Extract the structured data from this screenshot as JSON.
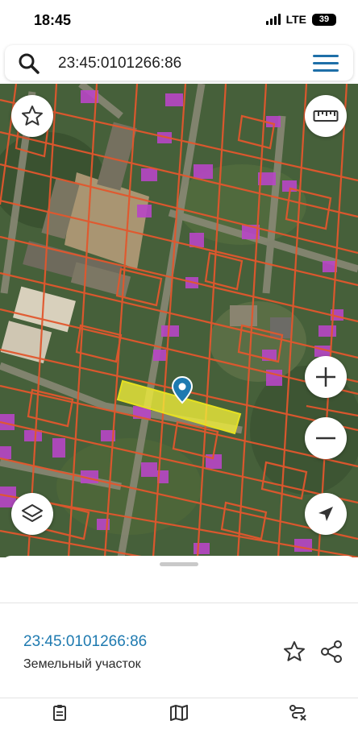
{
  "status": {
    "time": "18:45",
    "network": "LTE",
    "battery": "39"
  },
  "search": {
    "value": "23:45:0101266:86",
    "icon": "search-icon",
    "menu_icon": "hamburger-menu-icon"
  },
  "map": {
    "controls": {
      "favorites_icon": "star-icon",
      "measure_icon": "ruler-icon",
      "zoom_in_icon": "plus-icon",
      "zoom_out_icon": "minus-icon",
      "layers_icon": "layers-icon",
      "location_icon": "navigation-arrow-icon"
    },
    "selected_parcel_color": "#f2ee3a",
    "parcel_border_color": "#e2572d",
    "building_color": "#b846c6",
    "marker_color": "#1e7ab0"
  },
  "sheet": {
    "parcel_number": "23:45:0101266:86",
    "parcel_type": "Земельный участок",
    "favorite_icon": "star-outline-icon",
    "share_icon": "share-icon"
  },
  "nav": {
    "items": [
      {
        "icon": "clipboard-icon"
      },
      {
        "icon": "map-icon"
      },
      {
        "icon": "route-close-icon"
      }
    ]
  }
}
